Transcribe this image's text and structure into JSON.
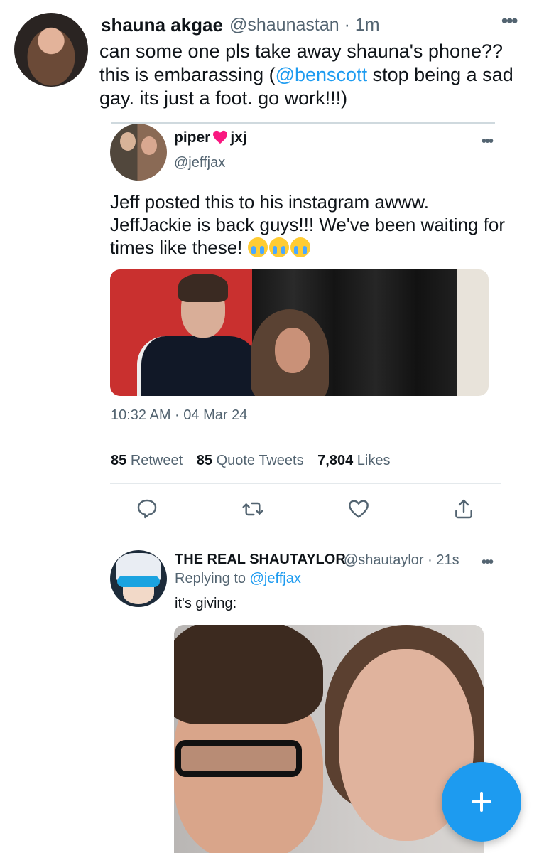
{
  "main_tweet": {
    "name": "shauna akgae",
    "handle_time": "@shaunastan · 1m",
    "text_pre": "can some one pls take away shauna's phone?? this is embarassing (",
    "mention": "@benscott",
    "text_post": " stop being a sad gay. its just a foot. go work!!!)",
    "more": "•••"
  },
  "quoted_tweet": {
    "name_first": "piper",
    "name_last": "jxj",
    "handle": "@jeffjax",
    "more": "•••",
    "text": "Jeff posted this to his instagram awww. JeffJackie is back guys!!! We've been waiting for times like these! ",
    "emoji": "loudly-crying-face",
    "timestamp": "10:32 AM · 04 Mar 24",
    "stats": {
      "retweets_count": "85",
      "retweets_label": "Retweet",
      "quotes_count": "85",
      "quotes_label": "Quote Tweets",
      "likes_count": "7,804",
      "likes_label": "Likes"
    }
  },
  "actions": [
    "reply-icon",
    "retweet-icon",
    "like-icon",
    "share-icon"
  ],
  "reply": {
    "name": "THE REAL SHAUTAYLOR",
    "handle_time": "@shautaylor · 21s",
    "more": "•••",
    "replying_prefix": "Replying to ",
    "replying_to": "@jeffjax",
    "text": "it's giving:"
  },
  "colors": {
    "accent": "#1d9bf0",
    "secondary_text": "#536471",
    "heart": "#f91880"
  }
}
